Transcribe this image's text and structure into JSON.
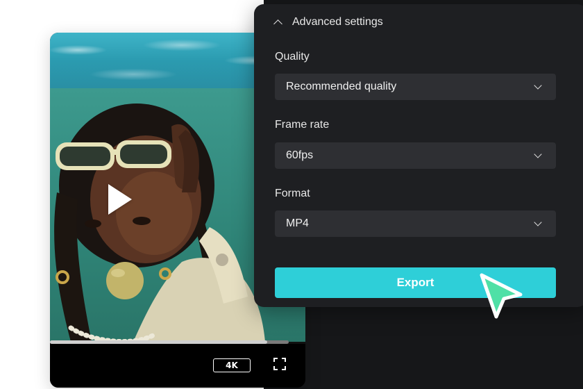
{
  "settings": {
    "header_title": "Advanced settings",
    "quality": {
      "label": "Quality",
      "value": "Recommended quality"
    },
    "frame_rate": {
      "label": "Frame rate",
      "value": "60fps"
    },
    "format": {
      "label": "Format",
      "value": "MP4"
    },
    "export_label": "Export"
  },
  "player": {
    "quality_badge": "4K",
    "progress_fraction": 0.91
  },
  "icons": {
    "collapse": "chevron-up-icon",
    "dropdown": "chevron-down-icon",
    "play": "play-icon",
    "fullscreen": "fullscreen-icon",
    "cursor": "pointer-cursor-icon"
  },
  "colors": {
    "accent": "#2ecfd8",
    "panel_bg": "#1e1f22",
    "select_bg": "#2e2f33",
    "cursor_fill": "#4fe0a6"
  }
}
